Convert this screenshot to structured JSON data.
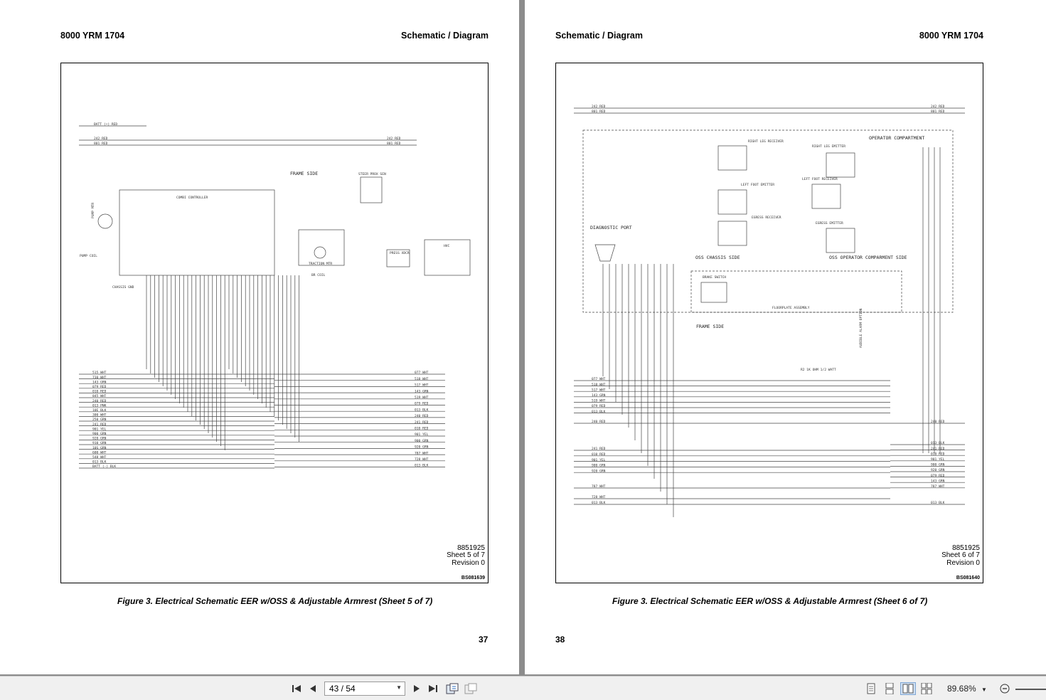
{
  "left_page": {
    "header_left": "8000 YRM 1704",
    "header_right": "Schematic / Diagram",
    "drawing_number": "8851925",
    "sheet": "Sheet 5 of 7",
    "revision": "Revision 0",
    "figure_code": "BS081639",
    "caption": "Figure 3. Electrical Schematic EER w/OSS & Adjustable Armrest (Sheet 5 of 7)",
    "page_number": "37",
    "labels": {
      "frame_side": "FRAME SIDE",
      "steer_prox": "STEER PROX SEN",
      "combi": "COMBI CONTROLLER",
      "pump_mtr": "PUMP MTR",
      "pump_coil": "PUMP COIL",
      "chassis_gnd": "CHASSIS GND",
      "traction_mtr": "TRACTION MTR",
      "br_coil": "BR COIL",
      "press_xdcr": "PRESS XDCR",
      "hvc": "HVC"
    },
    "left_wires": [
      "515 WHT",
      "730 WHT",
      "143 GRN",
      "079 RED",
      "010 RED",
      "845 WHT",
      "240 RED",
      "013 PNK",
      "10E BLK",
      "300 WHT",
      "250 GRN",
      "241 RED",
      "901 YEL",
      "900 GRN",
      "920 GRN",
      "910 GRN",
      "10S GRN",
      "600 WHT",
      "548 WHT",
      "013 BLK",
      "BATT (-) BLK"
    ],
    "right_wires": [
      "077 WHT",
      "518 WHT",
      "517 WHT",
      "143 GRN",
      "519 WHT",
      "079 RED",
      "013 BLK",
      "240 RED",
      "241 RED",
      "010 RED",
      "901 YEL",
      "900 GRN",
      "920 GRN",
      "787 WHT",
      "728 WHT",
      "013 BLK"
    ],
    "top_wires": [
      "BATT (+) RED",
      "242 RED",
      "801 RED"
    ]
  },
  "right_page": {
    "header_left": "Schematic / Diagram",
    "header_right": "8000 YRM 1704",
    "drawing_number": "8851925",
    "sheet": "Sheet 6 of 7",
    "revision": "Revision 0",
    "figure_code": "BS081640",
    "caption": "Figure 3. Electrical Schematic EER w/OSS & Adjustable Armrest (Sheet 6 of 7)",
    "page_number": "38",
    "labels": {
      "operator_compartment": "OPERATOR COMPARTMENT",
      "right_leg_receiver": "RIGHT LEG RECEIVER",
      "right_leg_emitter": "RIGHT LEG EMITTER",
      "left_foot_emitter": "LEFT FOOT EMITTER",
      "left_foot_receiver": "LEFT FOOT RECEIVER",
      "egress_receiver": "EGRESS RECEIVER",
      "egress_emitter": "EGRESS EMITTER",
      "oss_chassis_side": "OSS CHASSIS SIDE",
      "oss_operator_side": "OSS OPERATOR COMPARMENT SIDE",
      "diagnostic_port": "DIAGNOSTIC PORT",
      "brake_switch": "BRAKE SWITCH",
      "floorplate": "FLOORPLATE ASSEMBLY",
      "frame_side": "FRAME SIDE",
      "audible_alarm": "AUDIBLE ALARM OPTION",
      "resistor": "R2 1K OHM 1/2 WATT"
    },
    "left_wires": [
      "077 WHT",
      "518 WHT",
      "517 WHT",
      "143 GRN",
      "519 WHT",
      "079 RED",
      "013 BLK",
      "240 RED",
      "241 RED",
      "010 RED",
      "901 YEL",
      "900 GRN",
      "920 GRN",
      "787 WHT",
      "728 WHT",
      "013 BLK"
    ],
    "right_wires": [
      "240 RED",
      "013 BLK",
      "241 RED",
      "010 RED",
      "901 YEL",
      "900 GRN",
      "920 GRN",
      "079 RED",
      "143 GRN",
      "787 WHT",
      "013 BLK"
    ],
    "top_wires": [
      "242 RED",
      "801 RED"
    ]
  },
  "toolbar": {
    "page_field": "43 / 54",
    "zoom": "89.68%",
    "icons": [
      "first-page-icon",
      "prev-page-icon",
      "next-page-icon",
      "last-page-icon",
      "fit-page-icon",
      "fit-width-icon",
      "single-page-icon",
      "continuous-icon",
      "two-page-icon",
      "two-page-continuous-icon",
      "zoom-out-icon"
    ]
  }
}
